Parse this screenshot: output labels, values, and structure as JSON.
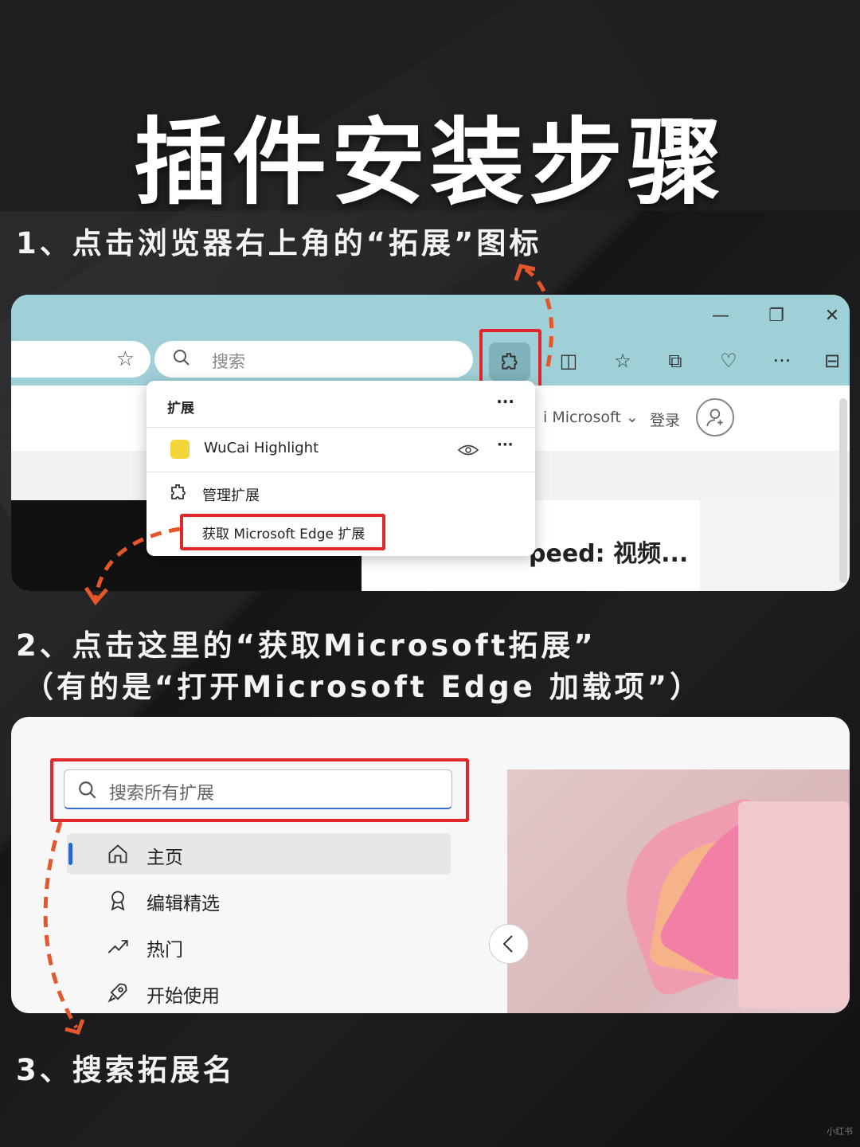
{
  "title": "插件安装步骤",
  "steps": {
    "s1": "1、点击浏览器右上角的“拓展”图标",
    "s2a": "2、点击这里的“获取Microsoft拓展”",
    "s2b": "（有的是“打开Microsoft Edge 加载项”）",
    "s3": "3、搜索拓展名"
  },
  "shot1": {
    "search_placeholder": "搜索",
    "popup": {
      "header": "扩展",
      "header_more": "···",
      "extension_name": "WuCai Highlight",
      "extension_more": "···",
      "manage": "管理扩展",
      "get_extensions": "获取 Microsoft Edge 扩展"
    },
    "page": {
      "microsoft_link": "i Microsoft ⌄",
      "login": "登录",
      "card_text": "peed: 视频..."
    }
  },
  "shot2": {
    "search_placeholder": "搜索所有扩展",
    "nav": [
      "主页",
      "编辑精选",
      "热门",
      "开始使用"
    ]
  },
  "colors": {
    "highlight_red": "#e0262b",
    "arrow_orange": "#e5562a",
    "edge_toolbar": "#9fd0d8",
    "accent_blue": "#2b66d0"
  },
  "watermark": "小红书"
}
